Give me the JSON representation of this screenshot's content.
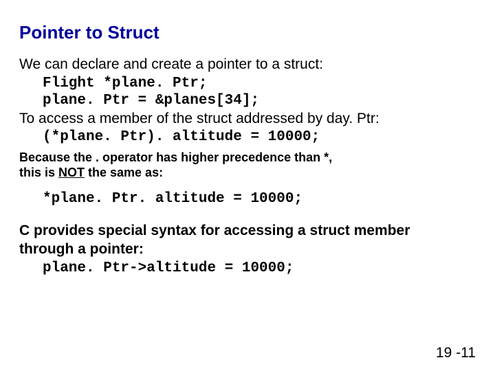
{
  "title": "Pointer to Struct",
  "p1": "We can declare and create a pointer to a struct:",
  "c1": "Flight *plane. Ptr;",
  "c2": "plane. Ptr = &planes[34];",
  "p2": "To access a member of the struct addressed by day. Ptr:",
  "c3": "(*plane. Ptr). altitude = 10000;",
  "s1a": "Because the . operator has higher precedence than *,",
  "s1b_pre": "this is ",
  "s1b_not": "NOT",
  "s1b_post": " the same as:",
  "c4": "*plane. Ptr. altitude = 10000;",
  "p3a": "C provides special syntax for accessing a struct member",
  "p3b": "through a pointer:",
  "c5": "plane. Ptr->altitude = 10000;",
  "page": "19 -11"
}
